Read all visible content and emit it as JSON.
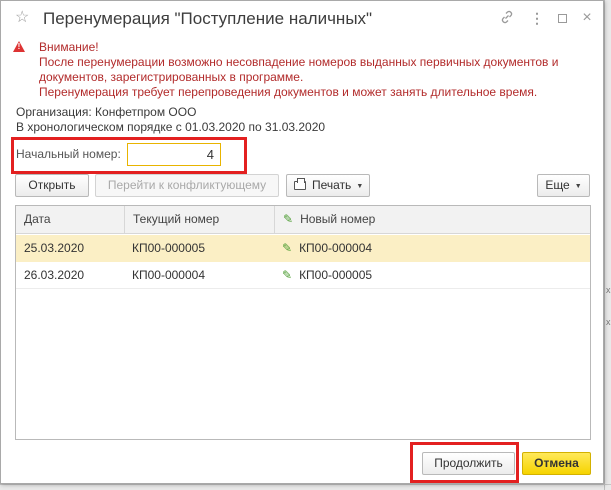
{
  "window": {
    "title": "Перенумерация \"Поступление наличных\"",
    "icons": [
      "star-icon",
      "link-icon",
      "more-icon",
      "maximize-icon",
      "close-icon"
    ],
    "close_glyph": "×",
    "more_glyph": "⋮"
  },
  "warning": {
    "heading": "Внимание!",
    "lines": [
      "После перенумерации возможно несовпадение номеров выданных первичных документов и",
      "документов, зарегистрированных в программе.",
      "Перенумерация требует перепроведения документов и может занять длительное время."
    ],
    "color": "#b22b2b"
  },
  "info": {
    "organization": "Организация: Конфетпром ООО",
    "period": "В хронологическом порядке с 01.03.2020 по 31.03.2020"
  },
  "start_number": {
    "label": "Начальный номер:",
    "value": "4"
  },
  "toolbar": {
    "open": "Открыть",
    "goto_conflict": "Перейти к конфликтующему",
    "print": "Печать",
    "more": "Еще"
  },
  "table": {
    "columns": [
      "Дата",
      "Текущий номер",
      "Новый номер"
    ],
    "rows": [
      {
        "date": "25.03.2020",
        "current": "КП00-000005",
        "new": "КП00-000004"
      },
      {
        "date": "26.03.2020",
        "current": "КП00-000004",
        "new": "КП00-000005"
      }
    ],
    "selected_row_color": "#fbefc5"
  },
  "footer": {
    "continue": "Продолжить",
    "cancel": "Отмена"
  },
  "accent": {
    "highlight_box": "#e32020",
    "primary_button": "#f6d400"
  }
}
